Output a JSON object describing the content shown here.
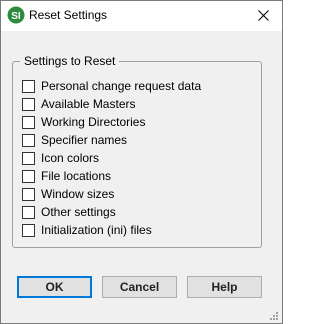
{
  "window": {
    "title": "Reset Settings",
    "app_icon": "si-logo-icon",
    "close_icon": "close-icon"
  },
  "group": {
    "legend": "Settings to Reset",
    "options": [
      {
        "label": "Personal change request data",
        "checked": false
      },
      {
        "label": "Available Masters",
        "checked": false
      },
      {
        "label": "Working Directories",
        "checked": false
      },
      {
        "label": "Specifier names",
        "checked": false
      },
      {
        "label": "Icon colors",
        "checked": false
      },
      {
        "label": "File locations",
        "checked": false
      },
      {
        "label": "Window sizes",
        "checked": false
      },
      {
        "label": "Other settings",
        "checked": false
      },
      {
        "label": "Initialization (ini) files",
        "checked": false
      }
    ]
  },
  "buttons": {
    "ok": "OK",
    "cancel": "Cancel",
    "help": "Help"
  },
  "colors": {
    "accent": "#0078d7",
    "logo_green": "#2e8b3d"
  }
}
